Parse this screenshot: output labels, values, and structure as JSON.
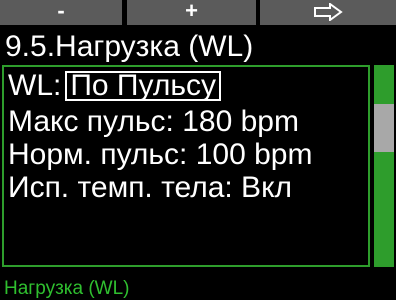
{
  "softkeys": {
    "left_label": "-",
    "middle_label": "+",
    "right_icon": "arrow-right-outline-icon"
  },
  "title": "9.5.Нагрузка (WL)",
  "settings": [
    {
      "label": "WL:",
      "value": "По Пульсу",
      "selected": true
    },
    {
      "text": "Макс пульс: 180 bpm"
    },
    {
      "text": "Норм. пульс: 100 bpm"
    },
    {
      "text": "Исп. темп. тела: Вкл"
    }
  ],
  "scrollbar": {
    "position_fraction": 0.25
  },
  "status_label": "Нагрузка (WL)",
  "colors": {
    "accent_green": "#2e9d2c",
    "status_text_green": "#2fbf2f",
    "softkey_gray": "#5b5b5b",
    "scroll_thumb": "#a8a8a8",
    "background": "#000000"
  }
}
